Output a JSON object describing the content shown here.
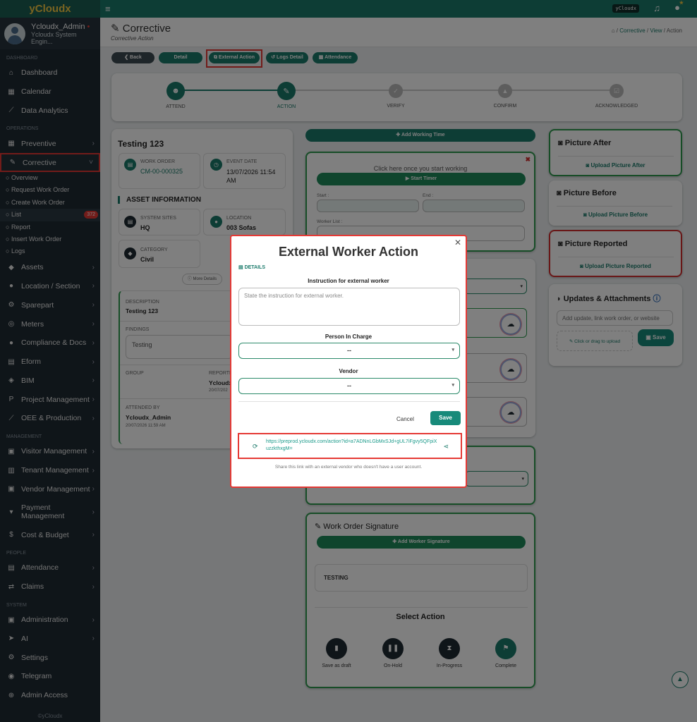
{
  "app": {
    "brand": "yCloudx",
    "user_name": "Ycloudx_Admin",
    "user_role": "Ycloudx System Engin...",
    "topbar_badge": "yCloudx",
    "footer": "©yCloudx"
  },
  "sidebar": {
    "sections": {
      "dashboard": "DASHBOARD",
      "operations": "OPERATIONS",
      "management": "MANAGEMENT",
      "people": "PEOPLE",
      "system": "SYSTEM"
    },
    "items": {
      "dashboard": "Dashboard",
      "calendar": "Calendar",
      "analytics": "Data Analytics",
      "preventive": "Preventive",
      "corrective": "Corrective",
      "assets": "Assets",
      "location": "Location / Section",
      "sparepart": "Sparepart",
      "meters": "Meters",
      "compliance": "Compliance & Docs",
      "eform": "Eform",
      "bim": "BIM",
      "project": "Project Management",
      "oee": "OEE & Production",
      "visitor": "Visitor Management",
      "tenant": "Tenant Management",
      "vendor": "Vendor Management",
      "payment": "Payment Management",
      "cost": "Cost & Budget",
      "attendance": "Attendance",
      "claims": "Claims",
      "administration": "Administration",
      "ai": "AI",
      "settings": "Settings",
      "telegram": "Telegram",
      "admin_access": "Admin Access"
    },
    "corrective_sub": [
      "Overview",
      "Request Work Order",
      "Create Work Order",
      "List",
      "Report",
      "Insert Work Order",
      "Logs"
    ],
    "list_count": "372"
  },
  "header": {
    "title": "Corrective",
    "subtitle": "Corrective Action",
    "breadcrumb": [
      "Corrective",
      "View",
      "Action"
    ]
  },
  "toolbar": {
    "back": "Back",
    "detail": "Detail",
    "external": "External Action",
    "logs": "Logs Detail",
    "attendance": "Attendance"
  },
  "steps": [
    "ATTEND",
    "ACTION",
    "VERIFY",
    "CONFIRM",
    "ACKNOWLEDGED"
  ],
  "left": {
    "title": "Testing 123",
    "wo_label": "WORK ORDER",
    "wo_value": "CM-00-000325",
    "date_label": "EVENT DATE",
    "date_value": "13/07/2026 11:54 AM",
    "asset_heading": "ASSET INFORMATION",
    "site_label": "SYSTEM SITES",
    "site_value": "HQ",
    "loc_label": "LOCATION",
    "loc_value": "003 Sofas",
    "cat_label": "CATEGORY",
    "cat_value": "Civil",
    "more": "More Details",
    "desc_label": "DESCRIPTION",
    "desc_value": "Testing 123",
    "findings_label": "FINDINGS",
    "findings_value": "Testing",
    "group_label": "GROUP",
    "reported_label": "REPORTE",
    "reported_value": "Ycloudx_",
    "reported_date": "20/07/202",
    "attended_label": "ATTENDED BY",
    "attended_value": "Ycloudx_Admin",
    "attended_date": "20/07/2026 11:59 AM"
  },
  "middle": {
    "add_working_time": "Add Working Time",
    "timer_hint": "Click here once you start working",
    "start_timer": "Start Timer",
    "start_label": "Start :",
    "end_label": "End :",
    "worker_list": "Worker List :",
    "signature_title": "Work Order Signature",
    "add_signature": "Add Worker Signature",
    "signature_text": "TESTING",
    "select_action": "Select Action",
    "actions": [
      "Save as draft",
      "On-Hold",
      "In-Progress",
      "Complete"
    ]
  },
  "right": {
    "after_title": "Picture After",
    "after_btn": "Upload Picture After",
    "before_title": "Picture Before",
    "before_btn": "Upload Picture Before",
    "reported_title": "Picture Reported",
    "reported_btn": "Upload Picture Reported",
    "updates_title": "Updates & Attachments",
    "updates_placeholder": "Add update, link work order, or website",
    "upload_hint": "Click or drag to upload",
    "save": "Save"
  },
  "modal": {
    "title": "External Worker Action",
    "details": "DETAILS",
    "instruction_label": "Instruction for external worker",
    "instruction_placeholder": "State the instruction for external worker.",
    "pic_label": "Person In Charge",
    "pic_value": "--",
    "vendor_label": "Vendor",
    "vendor_value": "--",
    "cancel": "Cancel",
    "save": "Save",
    "link": "https://preprod.ycloudx.com/action?id=a7ADNnLGbMxSJd+gUL7iFgvy5QFpiXuzzkthxgM=",
    "note": "Share this link with an external vendor who doesn't have a user account."
  },
  "colors": {
    "brand_green": "#1a7a6a",
    "accent_red": "#e53935",
    "card_green": "#2e9a4f"
  }
}
